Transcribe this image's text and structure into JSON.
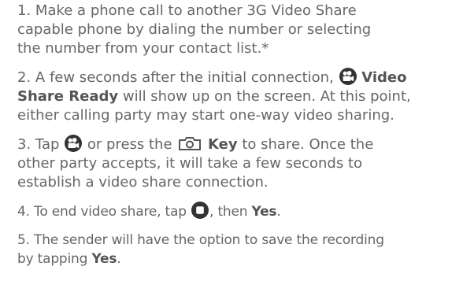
{
  "steps": [
    {
      "number": "1.",
      "line1": "Make a phone call to another 3G Video Share",
      "line2": "capable phone by dialing the number or selecting",
      "line3": "the number from your contact list.*"
    },
    {
      "number": "2.",
      "line1_pre": "A few seconds after the initial connection,",
      "line1_bold": "Video",
      "line2_bold": "Share Ready",
      "line2_post": "will show up on the screen. At this point,",
      "line3": "either calling party may start one-way video sharing."
    },
    {
      "number": "3.",
      "line1_pre": "Tap",
      "line1_mid": "or press the",
      "line1_bold": "Key",
      "line1_post": "to share. Once the",
      "line2": "other party accepts, it will take a few seconds to",
      "line3": "establish a video share connection."
    },
    {
      "number": "4.",
      "pre": "To end video share, tap",
      "mid": ", then",
      "bold": "Yes",
      "post": "."
    },
    {
      "number": "5.",
      "line1": "The sender will have the option to save the recording",
      "line2_pre": "by tapping",
      "line2_bold": "Yes",
      "line2_post": "."
    }
  ],
  "icons": {
    "video_share": "video-share-icon",
    "camera_key": "camera-key-icon",
    "stop": "stop-icon"
  },
  "colors": {
    "text": "#666666",
    "icon": "#333333"
  }
}
